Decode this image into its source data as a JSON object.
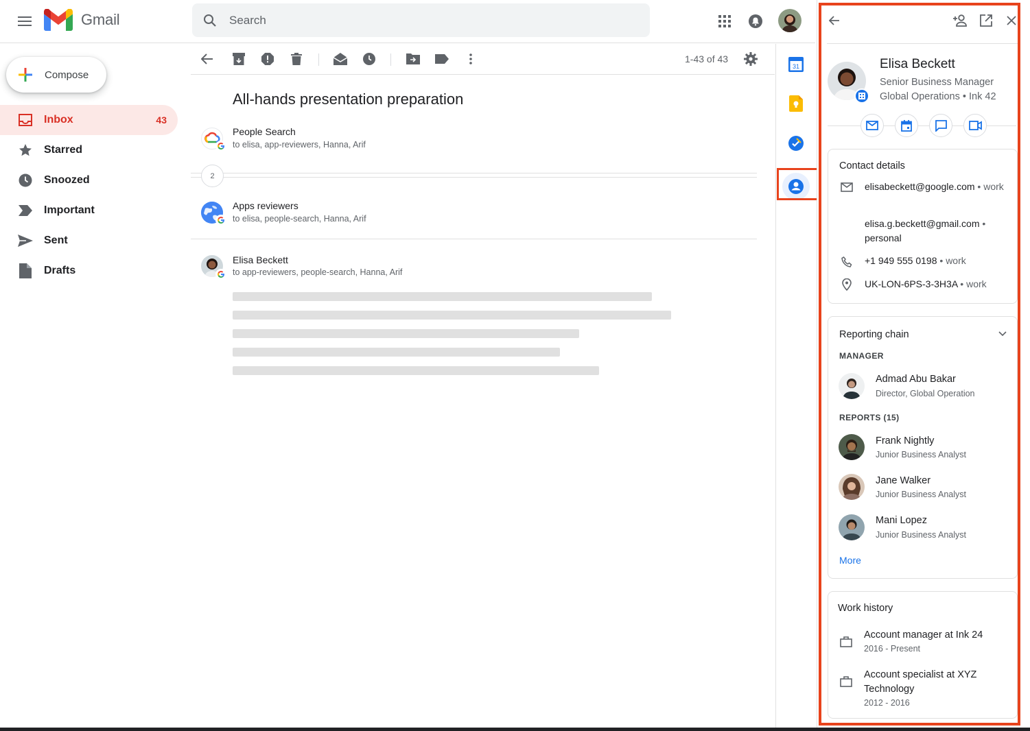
{
  "app": {
    "name": "Gmail",
    "search_placeholder": "Search"
  },
  "sidebar": {
    "compose_label": "Compose",
    "items": [
      {
        "label": "Inbox",
        "count": "43",
        "icon": "inbox-icon",
        "active": true
      },
      {
        "label": "Starred",
        "count": "",
        "icon": "star-icon"
      },
      {
        "label": "Snoozed",
        "count": "",
        "icon": "clock-icon"
      },
      {
        "label": "Important",
        "count": "",
        "icon": "important-icon"
      },
      {
        "label": "Sent",
        "count": "",
        "icon": "send-icon"
      },
      {
        "label": "Drafts",
        "count": "",
        "icon": "draft-icon"
      }
    ]
  },
  "toolbar": {
    "page_count": "1-43 of 43"
  },
  "thread": {
    "subject": "All-hands presentation preparation",
    "collapsed_count": "2",
    "messages": [
      {
        "sender": "People Search",
        "recipients": "to elisa, app-reviewers, Hanna, Arif"
      },
      {
        "sender": "Apps reviewers",
        "recipients": "to elisa, people-search, Hanna, Arif"
      },
      {
        "sender": "Elisa Beckett",
        "recipients": "to app-reviewers, people-search, Hanna, Arif"
      }
    ]
  },
  "side_strip": {
    "calendar_date": "31"
  },
  "contact": {
    "name": "Elisa Beckett",
    "title": "Senior Business Manager",
    "org": "Global Operations • Ink 42",
    "details_title": "Contact details",
    "email_work": "elisabeckett@google.com",
    "email_work_type": "work",
    "email_personal": "elisa.g.beckett@gmail.com",
    "email_personal_type": "personal",
    "phone": "+1 949 555 0198",
    "phone_type": "work",
    "location": "UK-LON-6PS-3-3H3A",
    "location_type": "work",
    "reporting_title": "Reporting chain",
    "manager_label": "MANAGER",
    "manager": {
      "name": "Admad Abu Bakar",
      "role": "Director, Global Operation"
    },
    "reports_label": "REPORTS (15)",
    "reports": [
      {
        "name": "Frank Nightly",
        "role": "Junior Business Analyst"
      },
      {
        "name": "Jane Walker",
        "role": "Junior Business Analyst"
      },
      {
        "name": "Mani Lopez",
        "role": "Junior Business Analyst"
      }
    ],
    "more_label": "More",
    "work_history_title": "Work history",
    "work_history": [
      {
        "title": "Account manager at Ink 24",
        "years": "2016 - Present"
      },
      {
        "title": "Account specialist at XYZ Technology",
        "years": "2012 - 2016"
      }
    ]
  },
  "colors": {
    "accent_red": "#d93025",
    "highlight": "#e8431c",
    "link_blue": "#1a73e8"
  }
}
